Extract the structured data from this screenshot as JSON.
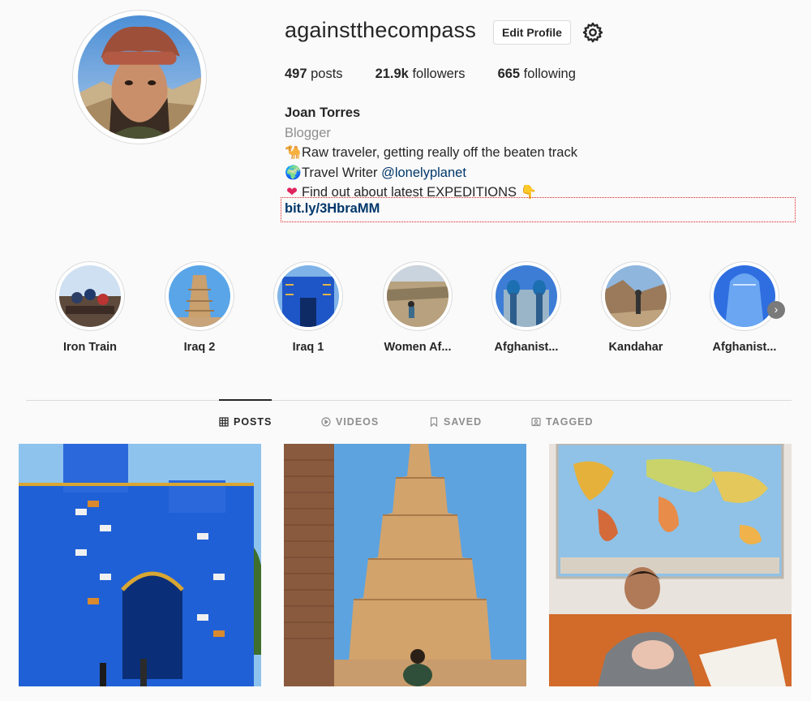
{
  "profile": {
    "username": "againstthecompass",
    "edit_label": "Edit Profile",
    "settings_icon": "gear-icon",
    "stats": {
      "posts_count": "497",
      "posts_label": " posts",
      "followers_count": "21.9k",
      "followers_label": " followers",
      "following_count": "665",
      "following_label": " following"
    },
    "full_name": "Joan Torres",
    "category": "Blogger",
    "bio": {
      "line1_emoji": "🐪",
      "line1_text": "Raw traveler, getting really off the beaten track",
      "line2_emoji": "🌍",
      "line2_text": "Travel Writer ",
      "line2_mention": "@lonelyplanet",
      "line3_emoji": "❤",
      "line3_text": "Find out about latest EXPEDITIONS ",
      "line3_emoji_end": "👇",
      "link": "bit.ly/3HbraMM"
    }
  },
  "highlights": [
    {
      "label": "Iron Train"
    },
    {
      "label": "Iraq 2"
    },
    {
      "label": "Iraq 1"
    },
    {
      "label": "Women Af..."
    },
    {
      "label": "Afghanist..."
    },
    {
      "label": "Kandahar"
    },
    {
      "label": "Afghanist..."
    }
  ],
  "highlights_next_icon": "chevron-right-icon",
  "tabs": [
    {
      "label": "POSTS",
      "icon": "grid-icon",
      "active": true
    },
    {
      "label": "VIDEOS",
      "icon": "play-icon",
      "active": false
    },
    {
      "label": "SAVED",
      "icon": "bookmark-icon",
      "active": false
    },
    {
      "label": "TAGGED",
      "icon": "tag-icon",
      "active": false
    }
  ],
  "colors": {
    "link": "#00376b",
    "muted": "#8e8e8e",
    "border": "#dbdbdb",
    "annotation": "#e02020"
  }
}
